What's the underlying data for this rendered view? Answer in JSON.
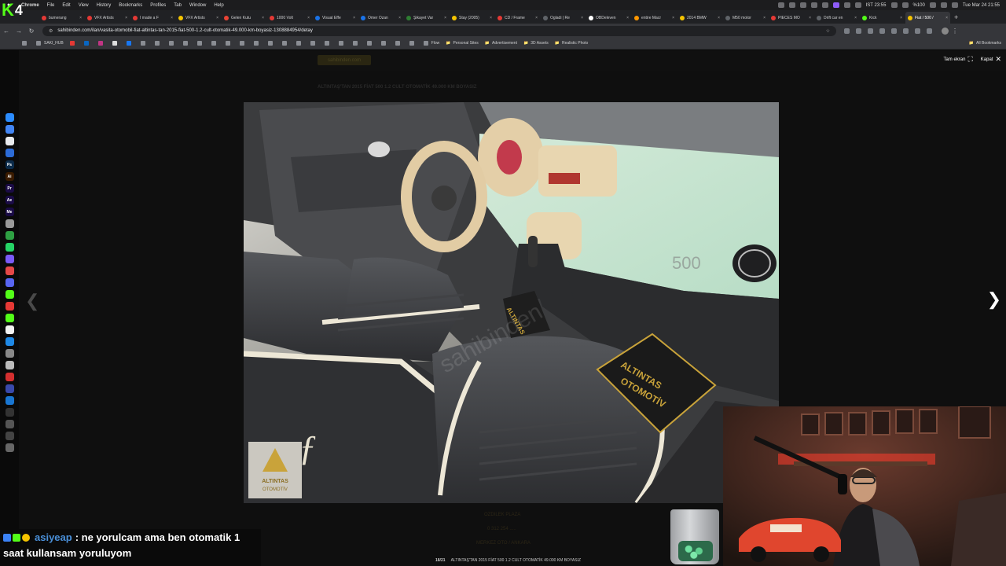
{
  "menubar": {
    "app_name": "Chrome",
    "items": [
      "File",
      "Edit",
      "View",
      "History",
      "Bookmarks",
      "Profiles",
      "Tab",
      "Window",
      "Help"
    ],
    "status": {
      "timezone_time": "IST 23:55",
      "battery": "%100",
      "datetime": "Tue Mar 24  21:55"
    }
  },
  "tabs": [
    {
      "label": "bumerang",
      "color": "#e53935",
      "active": false
    },
    {
      "label": "VFX Artists",
      "color": "#e53935",
      "active": false
    },
    {
      "label": "I made a F",
      "color": "#e53935",
      "active": false
    },
    {
      "label": "VFX Artists",
      "color": "#f5c400",
      "active": false
    },
    {
      "label": "Gelen Kutu",
      "color": "#ea4335",
      "active": false
    },
    {
      "label": "1000 Volt",
      "color": "#e53935",
      "active": false
    },
    {
      "label": "Visual Effe",
      "color": "#1a73e8",
      "active": false
    },
    {
      "label": "Omer Ozan",
      "color": "#1a73e8",
      "active": false
    },
    {
      "label": "Şikayet Var",
      "color": "#2e7d32",
      "active": false
    },
    {
      "label": "Stay (2005)",
      "color": "#f5c400",
      "active": false
    },
    {
      "label": "CD / Frame",
      "color": "#e53935",
      "active": false
    },
    {
      "label": "Ogladi | Re",
      "color": "#5f6368",
      "active": false
    },
    {
      "label": "OBDeleven",
      "color": "#ffffff",
      "active": false
    },
    {
      "label": "entire Macr",
      "color": "#ff9800",
      "active": false
    },
    {
      "label": "2014 BMW",
      "color": "#f5c400",
      "active": false
    },
    {
      "label": "M50 motor",
      "color": "#5f6368",
      "active": false
    },
    {
      "label": "PİECES MO",
      "color": "#e53935",
      "active": false
    },
    {
      "label": "Drift car en",
      "color": "#5f6368",
      "active": false
    },
    {
      "label": "Kick",
      "color": "#53fc18",
      "active": false
    },
    {
      "label": "Fiat / 500 /",
      "color": "#f5c400",
      "active": true
    }
  ],
  "toolbar": {
    "url": "sahibinden.com/ilan/vasita-otomobil-fiat-altintas-tan-2015-fiat-500-1.2-cult-otomatik-49.000-km-boyasiz-1308884954/detay"
  },
  "bookmarks": {
    "items": [
      "SAKI_HUB",
      "Flow",
      "Personal Sites",
      "Advertisement",
      "3D Assets",
      "Realistic Photo"
    ],
    "all_label": "All Bookmarks"
  },
  "page": {
    "bg_logo": "sahibinden.com",
    "bg_title": "ALTINTAŞ'TAN 2015 FİAT 500 1.2 CULT OTOMATİK 49.000 KM BOYASIZ",
    "bg_store": "OZDILEK PLAZA",
    "bg_phone": "0 312 254 .....",
    "bg_location": "MERKEZ OTO / ANKARA",
    "fullscreen_label": "Tam ekran",
    "close_label": "Kapat",
    "counter": "18/21",
    "caption": "ALTINTAŞ'TAN 2015 FİAT 500 1.2 CULT OTOMATİK 49.000 KM BOYASIZ",
    "photo_watermark_1": "ALTINTAS",
    "photo_watermark_2": "OTOMOTİV",
    "photo_badge_1": "ALTINTAS",
    "photo_badge_2": "OTOMOTİV",
    "dash_badge": "500",
    "photo_site_watermark": "sahibinden"
  },
  "stream": {
    "logo_letter": "K",
    "logo_number": "4"
  },
  "chat": {
    "username": "asiyeap",
    "message_line1": ": ne yorulcam ama ben otomatik 1",
    "message_line2": "saat kullansam yoruluyom"
  },
  "colors": {
    "accent_tab": "#35363a",
    "chrome_dark": "#202124",
    "kick_green": "#53fc18",
    "chat_user": "#4a90d9"
  }
}
